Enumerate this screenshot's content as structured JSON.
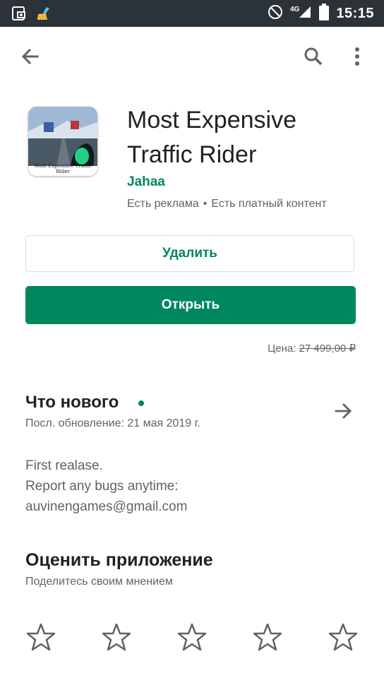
{
  "status_bar": {
    "time": "15:15",
    "network": "4G",
    "icons": [
      "screenshot-icon",
      "cleaner-broom-icon",
      "do-not-disturb-icon",
      "signal-icon",
      "battery-icon"
    ]
  },
  "app_bar": {
    "icons": [
      "back-arrow-icon",
      "search-icon",
      "more-vert-icon"
    ]
  },
  "app": {
    "title": "Most Expensive Traffic Rider",
    "icon_caption": "Most Expensive Traffic Rider",
    "developer": "Jahaa",
    "ads": "Есть реклама",
    "separator": "•",
    "iap": "Есть платный контент"
  },
  "actions": {
    "uninstall": "Удалить",
    "open": "Открыть"
  },
  "price": {
    "label": "Цена:",
    "value": "27 499,00 ₽"
  },
  "whats_new": {
    "title": "Что нового",
    "updated": "Посл. обновление: 21 мая 2019 г.",
    "notes": [
      "First realase.",
      "Report any bugs anytime:",
      "auvinengames@gmail.com"
    ]
  },
  "rate": {
    "title": "Оценить приложение",
    "subtitle": "Поделитесь своим мнением",
    "star_count": 5
  },
  "colors": {
    "accent": "#01875f",
    "status_bar": "#2b3238"
  }
}
